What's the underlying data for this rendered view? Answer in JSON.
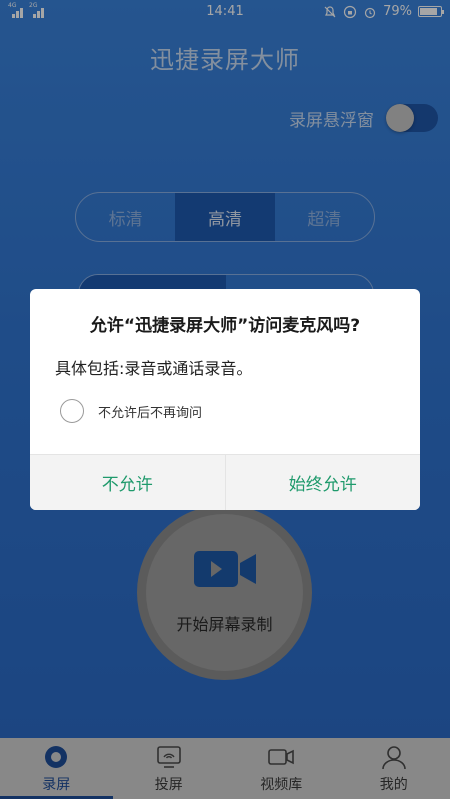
{
  "status_bar": {
    "signal_1": "4G",
    "signal_2": "2G",
    "time": "14:41",
    "battery": "79%"
  },
  "app": {
    "title": "迅捷录屏大师",
    "float_window_label": "录屏悬浮窗",
    "float_window_on": false,
    "quality_options": [
      "标清",
      "高清",
      "超清"
    ],
    "selected_quality": "高清",
    "record_button_label": "开始屏幕录制"
  },
  "dialog": {
    "title": "允许“迅捷录屏大师”访问麦克风吗?",
    "message": "具体包括:录音或通话录音。",
    "checkbox_label": "不允许后不再询问",
    "deny_label": "不允许",
    "allow_label": "始终允许"
  },
  "tabbar": {
    "items": [
      {
        "label": "录屏",
        "icon": "record-icon"
      },
      {
        "label": "投屏",
        "icon": "cast-icon"
      },
      {
        "label": "视频库",
        "icon": "video-library-icon"
      },
      {
        "label": "我的",
        "icon": "profile-icon"
      }
    ],
    "active_index": 0
  },
  "colors": {
    "primary_blue": "#2f73cf",
    "dialog_button_green": "#1f9a6c",
    "tab_active": "#1e4d99"
  }
}
